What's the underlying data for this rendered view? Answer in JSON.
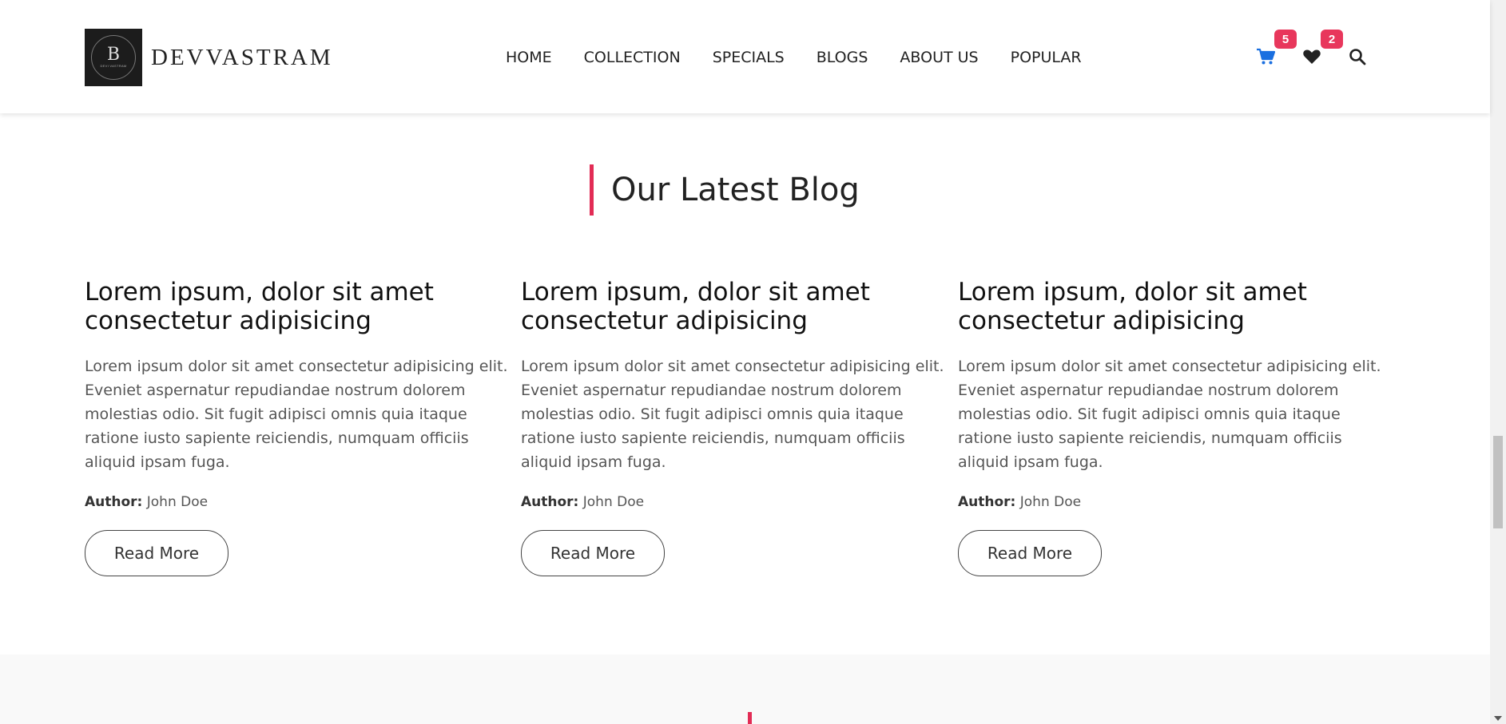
{
  "header": {
    "brand": "DEVVASTRAM",
    "logo_letter": "B",
    "logo_text": "DEVI VASTRAM",
    "nav": [
      "HOME",
      "COLLECTION",
      "SPECIALS",
      "BLOGS",
      "ABOUT US",
      "POPULAR"
    ],
    "cart_count": "5",
    "wishlist_count": "2",
    "icons": [
      "cart-icon",
      "heart-icon",
      "search-icon"
    ],
    "colors": {
      "cart": "#1a6fe0",
      "badge": "#e8375c",
      "accent": "#e22c55"
    }
  },
  "section": {
    "title": "Our Latest Blog"
  },
  "posts": [
    {
      "title": "Lorem ipsum, dolor sit amet consectetur adipisicing",
      "body": "Lorem ipsum dolor sit amet consectetur adipisicing elit. Eveniet aspernatur repudiandae nostrum dolorem molestias odio. Sit fugit adipisci omnis quia itaque ratione iusto sapiente reiciendis, numquam officiis aliquid ipsam fuga.",
      "author_label": "Author:",
      "author": "John Doe",
      "button": "Read More"
    },
    {
      "title": "Lorem ipsum, dolor sit amet consectetur adipisicing",
      "body": "Lorem ipsum dolor sit amet consectetur adipisicing elit. Eveniet aspernatur repudiandae nostrum dolorem molestias odio. Sit fugit adipisci omnis quia itaque ratione iusto sapiente reiciendis, numquam officiis aliquid ipsam fuga.",
      "author_label": "Author:",
      "author": "John Doe",
      "button": "Read More"
    },
    {
      "title": "Lorem ipsum, dolor sit amet consectetur adipisicing",
      "body": "Lorem ipsum dolor sit amet consectetur adipisicing elit. Eveniet aspernatur repudiandae nostrum dolorem molestias odio. Sit fugit adipisci omnis quia itaque ratione iusto sapiente reiciendis, numquam officiis aliquid ipsam fuga.",
      "author_label": "Author:",
      "author": "John Doe",
      "button": "Read More"
    }
  ]
}
